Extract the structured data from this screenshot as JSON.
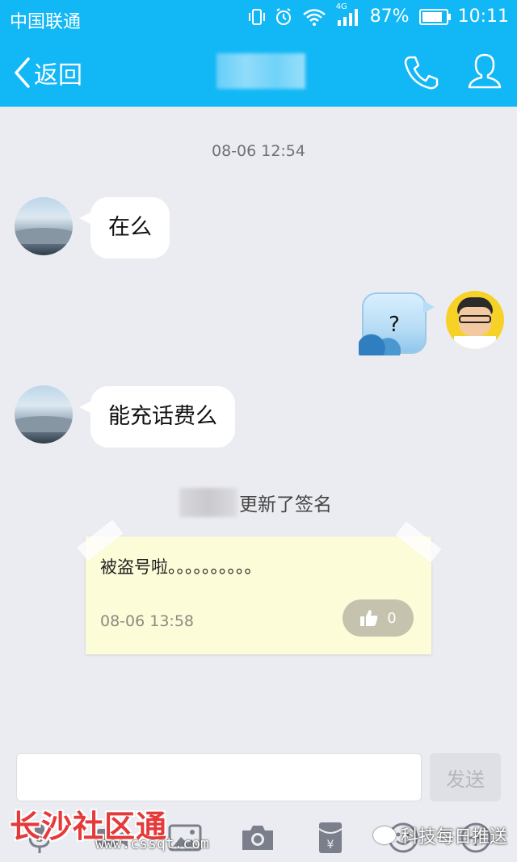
{
  "status_bar": {
    "carrier": "中国联通",
    "network": "4G",
    "battery_percent": "87%",
    "battery_level": 0.87,
    "time": "10:11"
  },
  "nav": {
    "back_label": "返回"
  },
  "chat": {
    "timestamp": "08-06 12:54",
    "messages": [
      {
        "side": "left",
        "text": "在么"
      },
      {
        "side": "right",
        "text": "?"
      },
      {
        "side": "left",
        "text": "能充话费么"
      }
    ]
  },
  "signature_update": {
    "notice_suffix": "更新了签名",
    "text": "被盗号啦。。。。。。。。。。",
    "date": "08-06 13:58",
    "like_count": "0"
  },
  "input_bar": {
    "placeholder": "",
    "send_label": "发送"
  },
  "toolbar": {
    "items": [
      "microphone-icon",
      "video-icon",
      "image-icon",
      "camera-icon",
      "red-packet-icon",
      "emoji-icon",
      "plus-icon"
    ]
  },
  "watermarks": {
    "left_title": "长沙社区通",
    "left_url": "www.cssqt.com",
    "right_text": "科技每日推送"
  },
  "colors": {
    "accent": "#12b7f5",
    "background": "#ebecf1",
    "note": "#fdfcd9"
  }
}
